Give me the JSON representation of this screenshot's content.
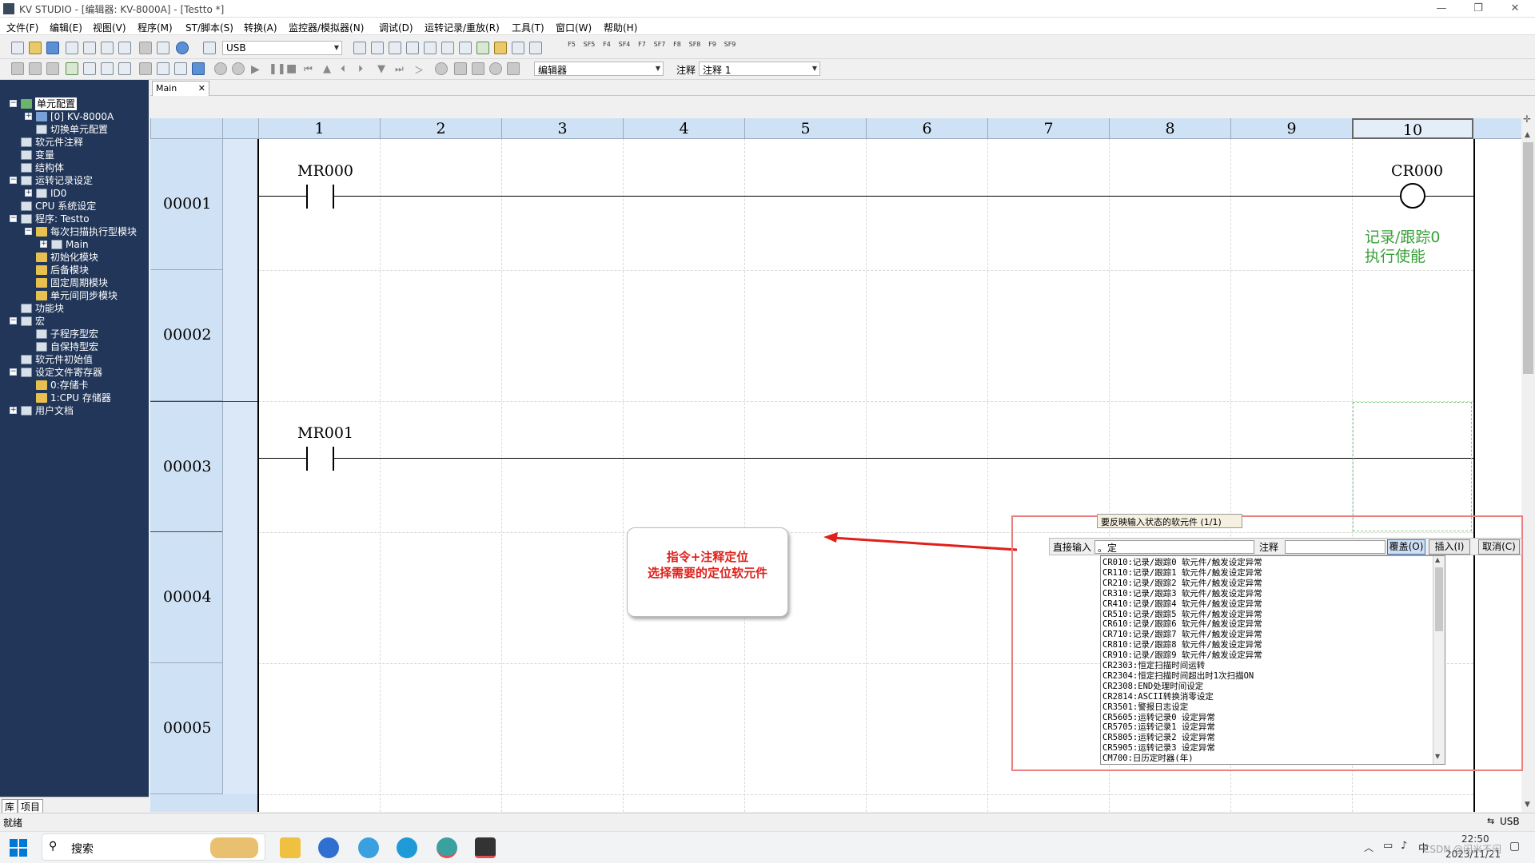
{
  "window": {
    "title": "KV STUDIO - [编辑器: KV-8000A] - [Testto *]",
    "min": "—",
    "max": "❐",
    "close": "✕"
  },
  "menu": [
    "文件(F)",
    "编辑(E)",
    "视图(V)",
    "程序(M)",
    "ST/脚本(S)",
    "转换(A)",
    "监控器/模拟器(N)",
    "调试(D)",
    "运转记录/重放(R)",
    "工具(T)",
    "窗口(W)",
    "帮助(H)"
  ],
  "toolbar": {
    "connection": "USB",
    "fkeys": [
      "F5",
      "SF5",
      "F4",
      "SF4",
      "F7",
      "SF7",
      "F8",
      "SF8",
      "F9",
      "SF9"
    ],
    "mode_combo": "编辑器",
    "comment_label": "注释",
    "comment_combo": "注释 1"
  },
  "project_panel": {
    "title": "项目",
    "pin": "⊓",
    "close": "✕",
    "tree": [
      {
        "label": "单元配置",
        "level": 0,
        "exp": "-",
        "icon": "unit-config-icon",
        "selected": true
      },
      {
        "label": "[0]  KV-8000A",
        "level": 1,
        "exp": "+",
        "icon": "plc-icon"
      },
      {
        "label": "切换单元配置",
        "level": 1,
        "exp": "",
        "icon": "switch-config-icon"
      },
      {
        "label": "软元件注释",
        "level": 0,
        "exp": "",
        "icon": "device-comment-icon"
      },
      {
        "label": "变量",
        "level": 0,
        "exp": "",
        "icon": "variable-icon"
      },
      {
        "label": "结构体",
        "level": 0,
        "exp": "",
        "icon": "struct-icon"
      },
      {
        "label": "运转记录设定",
        "level": 0,
        "exp": "-",
        "icon": "operation-record-icon"
      },
      {
        "label": "ID0",
        "level": 1,
        "exp": "+",
        "icon": "record-icon"
      },
      {
        "label": "CPU 系统设定",
        "level": 0,
        "exp": "",
        "icon": "cpu-settings-icon"
      },
      {
        "label": "程序: Testto",
        "level": 0,
        "exp": "-",
        "icon": "program-icon"
      },
      {
        "label": "每次扫描执行型模块",
        "level": 1,
        "exp": "-",
        "icon": "folder-icon"
      },
      {
        "label": "Main",
        "level": 2,
        "exp": "+",
        "icon": "module-icon"
      },
      {
        "label": "初始化模块",
        "level": 1,
        "exp": "",
        "icon": "folder-icon"
      },
      {
        "label": "后备模块",
        "level": 1,
        "exp": "",
        "icon": "folder-icon"
      },
      {
        "label": "固定周期模块",
        "level": 1,
        "exp": "",
        "icon": "folder-icon"
      },
      {
        "label": "单元间同步模块",
        "level": 1,
        "exp": "",
        "icon": "folder-icon"
      },
      {
        "label": "功能块",
        "level": 0,
        "exp": "",
        "icon": "function-block-icon"
      },
      {
        "label": "宏",
        "level": 0,
        "exp": "-",
        "icon": "macro-icon"
      },
      {
        "label": "子程序型宏",
        "level": 1,
        "exp": "",
        "icon": "subroutine-macro-icon"
      },
      {
        "label": "自保持型宏",
        "level": 1,
        "exp": "",
        "icon": "self-hold-macro-icon"
      },
      {
        "label": "软元件初始值",
        "level": 0,
        "exp": "",
        "icon": "device-init-icon"
      },
      {
        "label": "设定文件寄存器",
        "level": 0,
        "exp": "-",
        "icon": "file-register-icon"
      },
      {
        "label": "0:存储卡",
        "level": 1,
        "exp": "",
        "icon": "folder-icon"
      },
      {
        "label": "1:CPU 存储器",
        "level": 1,
        "exp": "",
        "icon": "folder-icon"
      },
      {
        "label": "用户文档",
        "level": 0,
        "exp": "+",
        "icon": "user-doc-icon"
      }
    ],
    "footer_tabs": [
      "库",
      "项目"
    ]
  },
  "editor": {
    "tab": "Main",
    "tab_close": "✕",
    "columns": [
      "1",
      "2",
      "3",
      "4",
      "5",
      "6",
      "7",
      "8",
      "9",
      "10"
    ],
    "rows": [
      "00001",
      "00002",
      "00003",
      "00004",
      "00005"
    ],
    "rung1": {
      "contact": "MR000",
      "coil": "CR000",
      "comment_line1": "记录/跟踪0",
      "comment_line2": "执行使能"
    },
    "rung3": {
      "contact": "MR001"
    }
  },
  "callout": {
    "line1": "指令+注释定位",
    "line2": "选择需要的定位软元件"
  },
  "popup": {
    "title": "要反映输入状态的软元件  (1/1)",
    "direct_input_label": "直接输入",
    "direct_input_value": "。定",
    "comment_label": "注释",
    "comment_value": "",
    "overwrite_button": "覆盖(O)",
    "insert_button": "插入(I)",
    "cancel_button": "取消(C)",
    "items": [
      "CR010:记录/跟踪0 软元件/触发设定异常",
      "CR110:记录/跟踪1 软元件/触发设定异常",
      "CR210:记录/跟踪2 软元件/触发设定异常",
      "CR310:记录/跟踪3 软元件/触发设定异常",
      "CR410:记录/跟踪4 软元件/触发设定异常",
      "CR510:记录/跟踪5 软元件/触发设定异常",
      "CR610:记录/跟踪6 软元件/触发设定异常",
      "CR710:记录/跟踪7 软元件/触发设定异常",
      "CR810:记录/跟踪8 软元件/触发设定异常",
      "CR910:记录/跟踪9 软元件/触发设定异常",
      "CR2303:恒定扫描时间运转",
      "CR2304:恒定扫描时间超出时1次扫描ON",
      "CR2308:END处理时间设定",
      "CR2814:ASCII转换消零设定",
      "CR3501:警报日志设定",
      "CR5605:运转记录0 设定异常",
      "CR5705:运转记录1 设定异常",
      "CR5805:运转记录2 设定异常",
      "CR5905:运转记录3 设定异常",
      "CM700:日历定时器(年)"
    ]
  },
  "status": {
    "left": "就绪",
    "right": "USB"
  },
  "taskbar": {
    "search": "搜索",
    "time": "22:50",
    "date": "2023/11/21",
    "lang": "中",
    "watermark": "CSDN @闲米不闲"
  },
  "colors": {
    "panel_bg": "#213658",
    "header_bg": "#cfe2f5",
    "comment_green": "#3aa03a",
    "callout_red": "#e0201a"
  }
}
